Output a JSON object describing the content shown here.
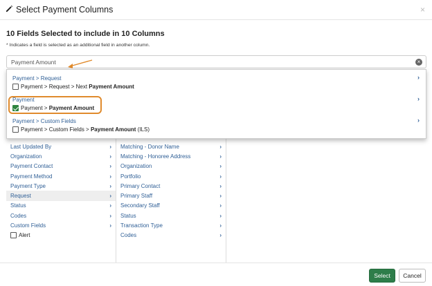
{
  "modal": {
    "title": "Select Payment Columns",
    "icon": "pencil-icon",
    "close_label": "×"
  },
  "summary": {
    "prefix": "10 Fields Selected to include in ",
    "count": "10",
    "suffix": " Columns"
  },
  "note": "* Indicates a field is selected as an additional field in another column.",
  "search": {
    "value": "Payment Amount",
    "placeholder": ""
  },
  "dropdown": {
    "groups": [
      {
        "path": "Payment > Request",
        "item_prefix": "Payment > Request > Next ",
        "item_bold": "Payment Amount",
        "item_suffix": "",
        "checked": false
      },
      {
        "path": "Payment",
        "item_prefix": "Payment > ",
        "item_bold": "Payment Amount",
        "item_suffix": "",
        "checked": true
      },
      {
        "path": "Payment > Custom Fields",
        "item_prefix": "Payment > Custom Fields > ",
        "item_bold": "Payment Amount",
        "item_suffix": " (ILS)",
        "checked": false
      }
    ]
  },
  "column1": {
    "rows": [
      "Last Updated By",
      "Organization",
      "Payment Contact",
      "Payment Method",
      "Payment Type",
      "Request",
      "Status",
      "Codes",
      "Custom Fields"
    ],
    "check_label": "Alert"
  },
  "column2": {
    "rows": [
      "Matching - Donor Name",
      "Matching - Honoree Address",
      "Organization",
      "Portfolio",
      "Primary Contact",
      "Primary Staff",
      "Secondary Staff",
      "Status",
      "Transaction Type",
      "Codes"
    ]
  },
  "footer": {
    "select_label": "Select",
    "cancel_label": "Cancel"
  },
  "colors": {
    "accent_green": "#2e7d4a",
    "link_blue": "#2f5f96",
    "highlight_orange": "#e08a2c"
  }
}
